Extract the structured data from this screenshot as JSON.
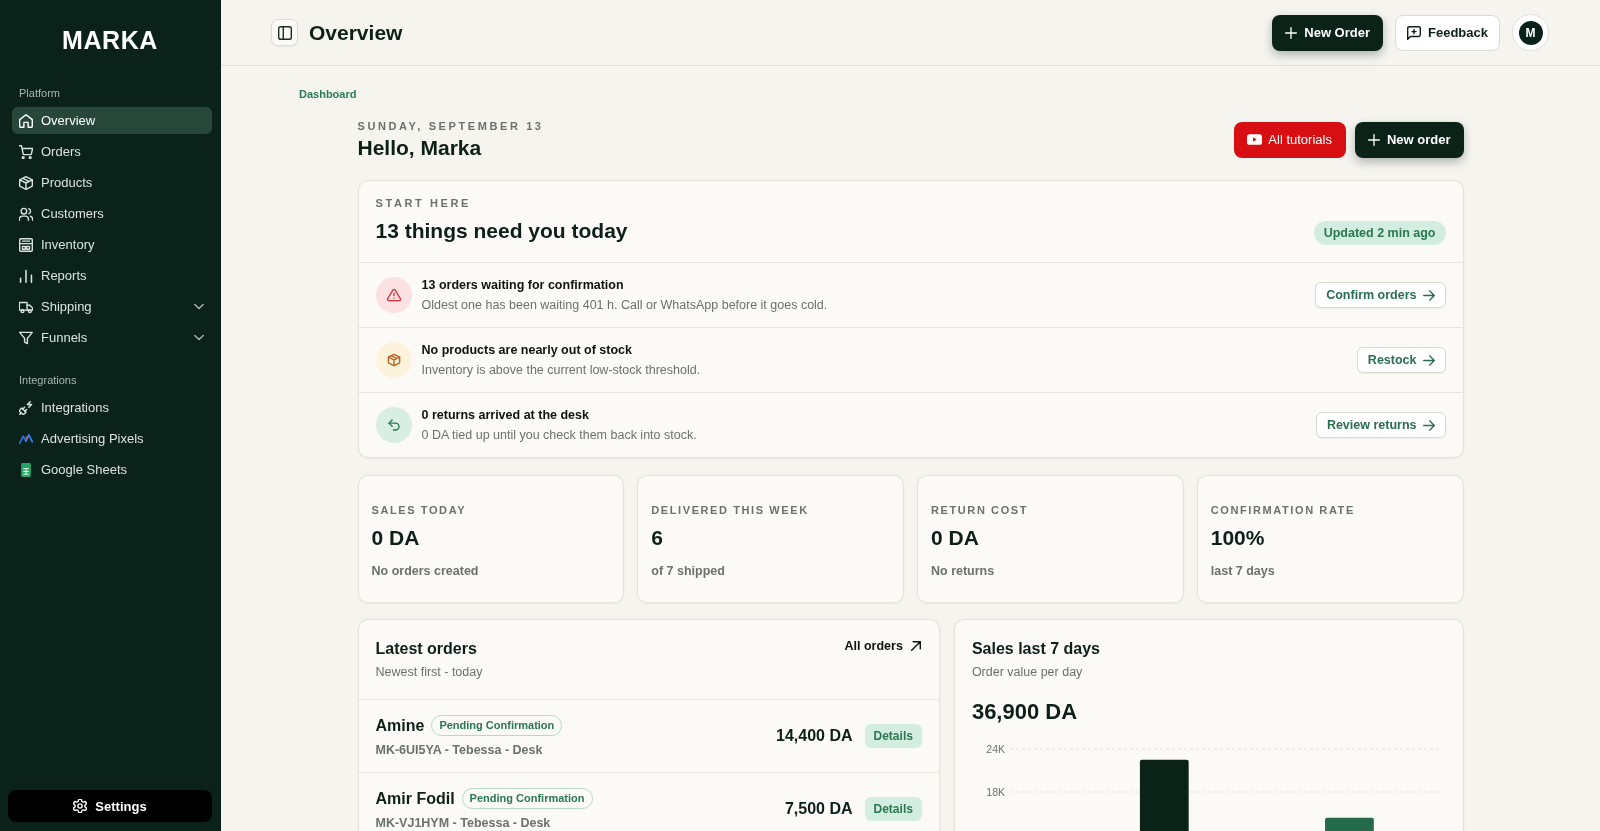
{
  "sidebar": {
    "logo": "MARKA",
    "sections": [
      {
        "label": "Platform",
        "items": [
          {
            "label": "Overview",
            "selected": true,
            "expandable": false
          },
          {
            "label": "Orders",
            "selected": false,
            "expandable": false
          },
          {
            "label": "Products",
            "selected": false,
            "expandable": false
          },
          {
            "label": "Customers",
            "selected": false,
            "expandable": false
          },
          {
            "label": "Inventory",
            "selected": false,
            "expandable": false
          },
          {
            "label": "Reports",
            "selected": false,
            "expandable": false
          },
          {
            "label": "Shipping",
            "selected": false,
            "expandable": true
          },
          {
            "label": "Funnels",
            "selected": false,
            "expandable": true
          }
        ]
      },
      {
        "label": "Integrations",
        "items": [
          {
            "label": "Integrations",
            "selected": false,
            "expandable": false
          },
          {
            "label": "Advertising Pixels",
            "selected": false,
            "expandable": false
          },
          {
            "label": "Google Sheets",
            "selected": false,
            "expandable": false
          }
        ]
      }
    ],
    "settings": "Settings"
  },
  "header": {
    "title": "Overview",
    "actions": [
      {
        "kind": "primary",
        "label": "New Order"
      },
      {
        "kind": "outline",
        "label": "Feedback"
      }
    ],
    "avatar": "M"
  },
  "breadcrumb": "Dashboard",
  "greeting": {
    "date": "SUNDAY, SEPTEMBER 13",
    "title": "Hello, Marka",
    "actions": [
      {
        "kind": "video",
        "label": "All tutorials"
      },
      {
        "kind": "primary",
        "label": "New order"
      }
    ]
  },
  "start_here": {
    "eyebrow": "START HERE",
    "title": "13 things need you today",
    "badge": "Updated 2 min ago",
    "tasks": [
      {
        "kind": "warning",
        "title": "13 orders waiting for confirmation",
        "description": "Oldest one has been waiting 401 h. Call or WhatsApp before it goes cold.",
        "action": "Confirm orders"
      },
      {
        "kind": "stock",
        "title": "No products are nearly out of stock",
        "description": "Inventory is above the current low-stock threshold.",
        "action": "Restock"
      },
      {
        "kind": "returns",
        "title": "0 returns arrived at the desk",
        "description": "0 DA tied up until you check them back into stock.",
        "action": "Review returns"
      }
    ]
  },
  "stats": [
    {
      "label": "SALES TODAY",
      "value": "0 DA",
      "note": "No orders created"
    },
    {
      "label": "DELIVERED THIS WEEK",
      "value": "6",
      "note": "of 7 shipped"
    },
    {
      "label": "RETURN COST",
      "value": "0 DA",
      "note": "No returns"
    },
    {
      "label": "CONFIRMATION RATE",
      "value": "100%",
      "note": "last 7 days"
    }
  ],
  "latest_orders": {
    "title": "Latest orders",
    "subtitle": "Newest first - today",
    "link": "All orders",
    "orders": [
      {
        "customer": "Amine",
        "status": "Pending Confirmation",
        "reference": "MK-6UI5YA - Tebessa - Desk",
        "amount": "14,400 DA",
        "action": "Details"
      },
      {
        "customer": "Amir Fodil",
        "status": "Pending Confirmation",
        "reference": "MK-VJ1HYM - Tebessa - Desk",
        "amount": "7,500 DA",
        "action": "Details"
      }
    ]
  },
  "sales": {
    "title": "Sales last 7 days",
    "subtitle": "Order value per day",
    "total": "36,900 DA",
    "chart_data": {
      "type": "bar",
      "stacked": true,
      "series": [
        {
          "color": "#0b2219",
          "values": [
            0,
            0,
            22500,
            0,
            0,
            0,
            0
          ]
        },
        {
          "color": "#236b4b",
          "values": [
            0,
            0,
            0,
            0,
            0,
            14400,
            0
          ]
        }
      ],
      "ylim": [
        0,
        24000
      ],
      "yticks": [
        {
          "value": 24000,
          "label": "24K"
        },
        {
          "value": 18000,
          "label": "18K"
        }
      ]
    }
  }
}
